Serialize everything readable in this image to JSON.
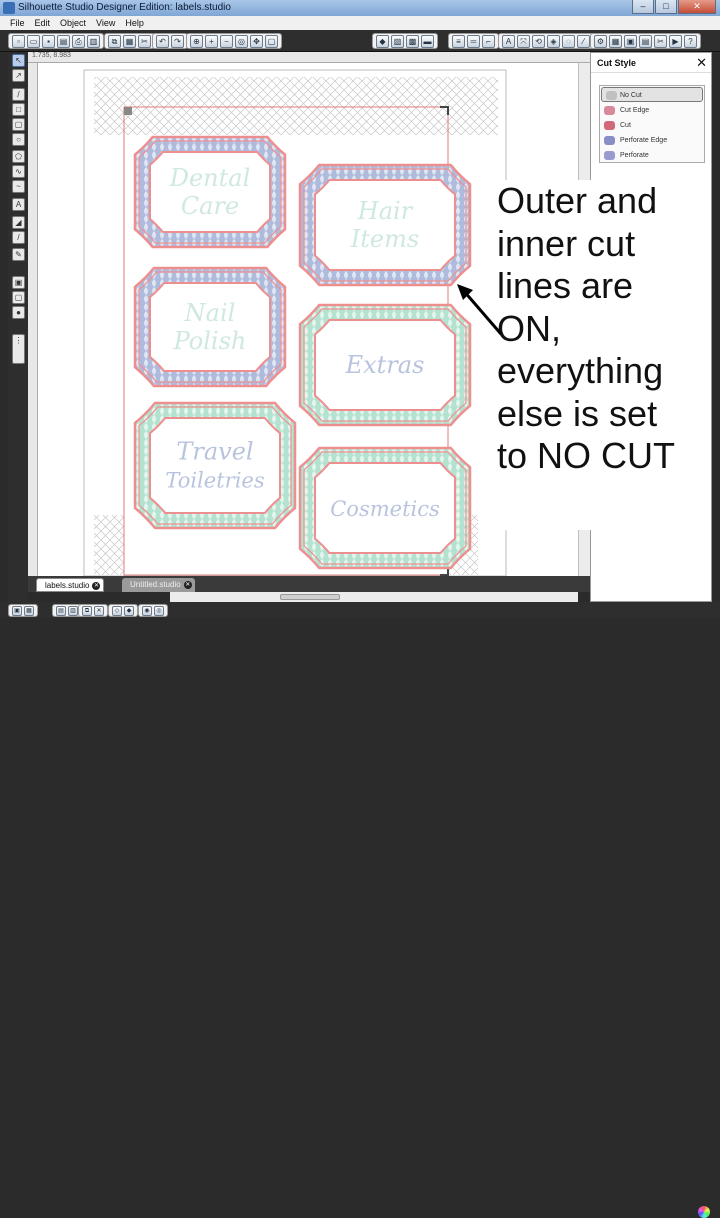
{
  "window": {
    "title": "Silhouette Studio Designer Edition: labels.studio"
  },
  "menu": [
    "File",
    "Edit",
    "Object",
    "View",
    "Help"
  ],
  "ruler": {
    "coords": "1.735, 8.983"
  },
  "labels": [
    {
      "line1": "Dental",
      "line2": "Care",
      "frame": "#ee8f8f",
      "pattern": "#b8c4de",
      "text_color": "#cfe8e0"
    },
    {
      "line1": "Hair",
      "line2": "Items",
      "frame": "#ee8f8f",
      "pattern": "#b8c4de",
      "text_color": "#cfe8e0"
    },
    {
      "line1": "Nail",
      "line2": "Polish",
      "frame": "#ee8f8f",
      "pattern": "#b8c4de",
      "text_color": "#cfe8e0"
    },
    {
      "line1": "Extras",
      "line2": "",
      "frame": "#ee8f8f",
      "pattern": "#bfe6d8",
      "text_color": "#b8c4de"
    },
    {
      "line1": "Travel",
      "line2": "Toiletries",
      "frame": "#ee8f8f",
      "pattern": "#bfe6d8",
      "text_color": "#b8c4de"
    },
    {
      "line1": "Cosmetics",
      "line2": "",
      "frame": "#ee8f8f",
      "pattern": "#bfe6d8",
      "text_color": "#b8c4de"
    }
  ],
  "callout": {
    "lines": [
      "Outer and",
      "inner cut",
      "lines are",
      "ON,",
      "everything",
      "else is set",
      "to NO CUT"
    ]
  },
  "tabs": [
    {
      "label": "labels.studio",
      "active": true
    },
    {
      "label": "Untitled.studio",
      "active": false
    }
  ],
  "cut_style_panel": {
    "title": "Cut Style",
    "close": "✕",
    "options": [
      {
        "label": "No Cut",
        "selected": true,
        "icon_color": "#c0c0c0"
      },
      {
        "label": "Cut Edge",
        "selected": false,
        "icon_color": "#d88a9a"
      },
      {
        "label": "Cut",
        "selected": false,
        "icon_color": "#d06a78"
      },
      {
        "label": "Perforate Edge",
        "selected": false,
        "icon_color": "#8a8ec8"
      },
      {
        "label": "Perforate",
        "selected": false,
        "icon_color": "#9a9ad0"
      }
    ]
  }
}
